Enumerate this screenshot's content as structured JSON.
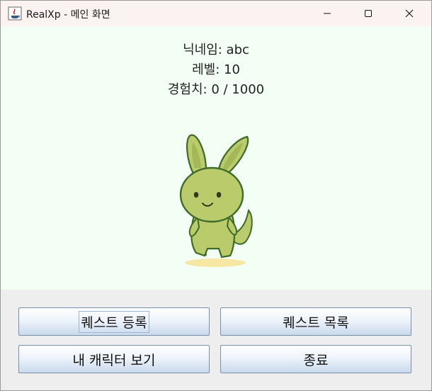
{
  "window": {
    "title": "RealXp - 메인 화면",
    "icons": [
      "java-app-icon",
      "minimize-icon",
      "maximize-icon",
      "close-icon"
    ]
  },
  "profile": {
    "nickname_line": "닉네임: abc",
    "level_line": "레벨: 10",
    "exp_line": "경험치: 0 / 1000"
  },
  "character": {
    "image": "green-bunny-creature-illustration"
  },
  "buttons": {
    "quest_register": "퀘스트 등록",
    "quest_list": "퀘스트 목록",
    "my_character": "내 캐릭터 보기",
    "exit": "종료"
  },
  "colors": {
    "titlebar_bg": "#fbf2f2",
    "content_bg": "#f3fff4",
    "button_bottom_panel": "#eeeeee",
    "character_body": "#b9cb6a",
    "character_outline": "#3f6b28"
  }
}
